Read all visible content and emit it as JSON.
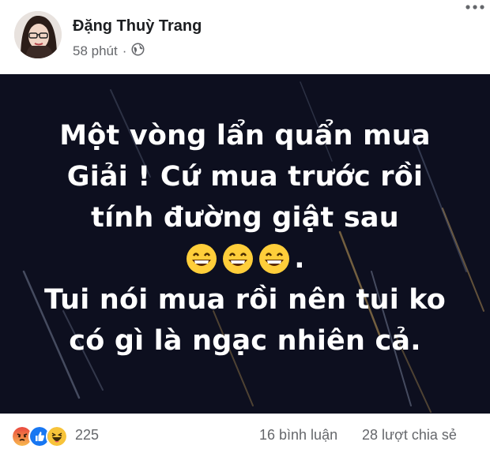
{
  "author": {
    "name": "Đặng Thuỳ Trang",
    "time": "58 phút",
    "separator": "·",
    "audience_icon": "globe-icon"
  },
  "post": {
    "background_color": "#0d0f1f",
    "lines": [
      "Một vòng lẩn quẩn mua",
      "Giải ! Cứ mua trước rồi",
      "tính đường giật sau",
      ".",
      "Tui nói mua rồi nên tui ko",
      "có gì là ngạc nhiên cả."
    ],
    "emojis": [
      "grinning-face-icon",
      "grinning-face-icon",
      "grinning-face-icon"
    ]
  },
  "footer": {
    "reaction_icons": [
      "angry-icon",
      "like-icon",
      "haha-icon"
    ],
    "reaction_count": "225",
    "comments": "16 bình luận",
    "shares": "28 lượt chia sẻ"
  }
}
